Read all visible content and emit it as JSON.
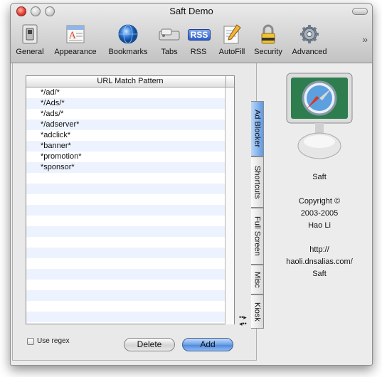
{
  "window": {
    "title": "Saft Demo"
  },
  "toolbar": {
    "items": [
      {
        "label": "General",
        "icon": "switch-icon"
      },
      {
        "label": "Appearance",
        "icon": "appearance-icon"
      },
      {
        "label": "Bookmarks",
        "icon": "globe-icon"
      },
      {
        "label": "Tabs",
        "icon": "tabs-icon"
      },
      {
        "label": "RSS",
        "icon": "rss-icon",
        "badge": "RSS"
      },
      {
        "label": "AutoFill",
        "icon": "pencil-icon"
      },
      {
        "label": "Security",
        "icon": "lock-icon"
      },
      {
        "label": "Advanced",
        "icon": "gear-icon"
      }
    ],
    "overflow": "»"
  },
  "table": {
    "header": "URL Match Pattern",
    "rows": [
      "*/ad/*",
      "*/Ads/*",
      "*/ads/*",
      "*/adserver*",
      "*adclick*",
      "*banner*",
      "*promotion*",
      "*sponsor*",
      "",
      "",
      "",
      "",
      "",
      "",
      "",
      "",
      "",
      "",
      "",
      "",
      "",
      ""
    ]
  },
  "regex_label": "Use regex",
  "buttons": {
    "delete": "Delete",
    "add": "Add"
  },
  "tabs": [
    {
      "label": "Ad Blocker",
      "active": true
    },
    {
      "label": "Shortcuts",
      "active": false
    },
    {
      "label": "Full Screen",
      "active": false
    },
    {
      "label": "Misc",
      "active": false
    },
    {
      "label": "Kiosk",
      "active": false
    }
  ],
  "tab_scroll": {
    "next": "••▸",
    "prev": "◂••"
  },
  "about": {
    "app_name": "Saft",
    "copyright": "Copyright ©",
    "years": "2003-2005",
    "author": "Hao Li",
    "url_line1": "http://",
    "url_line2": "haoli.dnsalias.com/",
    "url_line3": "Saft"
  },
  "colors": {
    "accent": "#5e98e3",
    "close": "#e0392b"
  }
}
